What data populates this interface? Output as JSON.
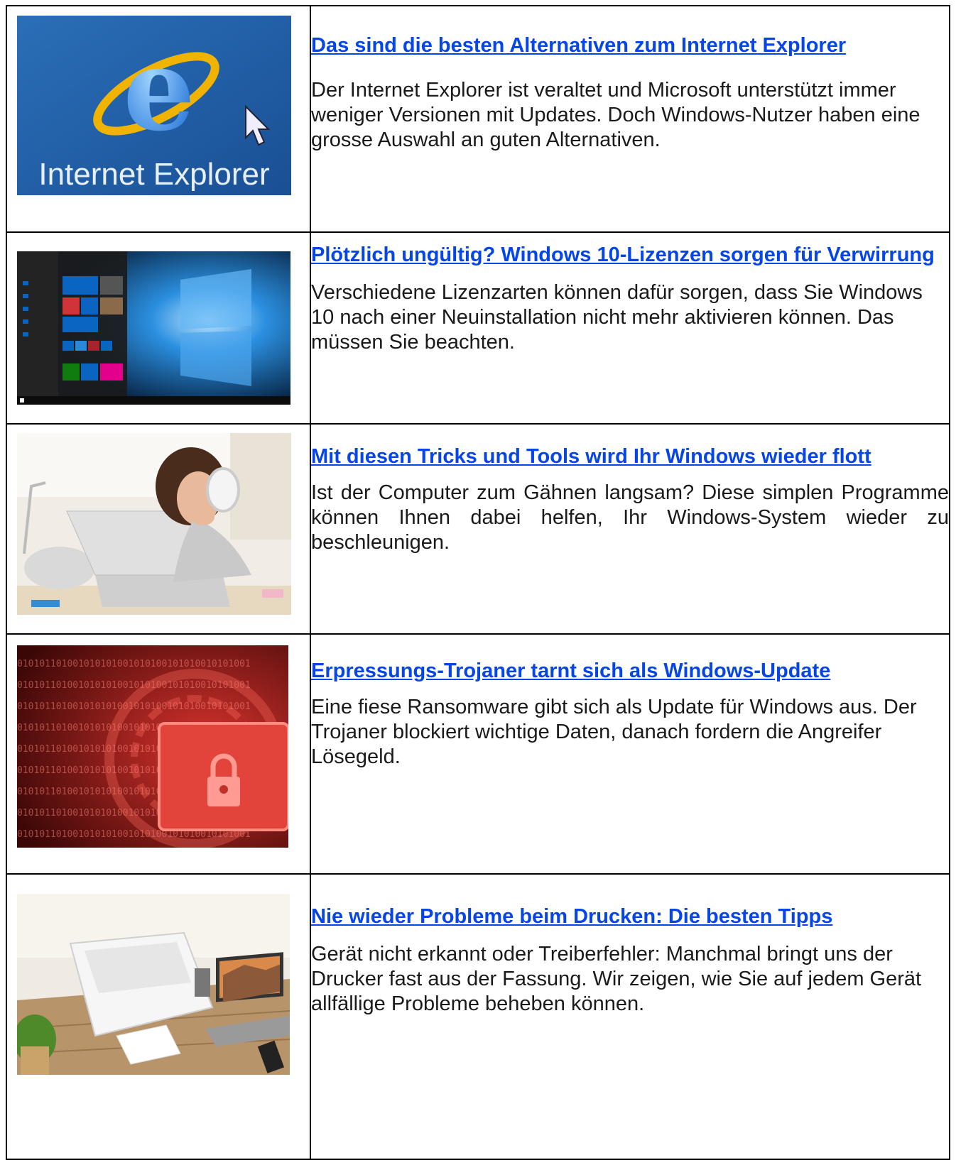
{
  "articles": [
    {
      "title": "Das sind die besten Alternativen zum Internet Explorer",
      "summary": "Der Internet Explorer ist veraltet und Microsoft unterstützt immer weniger Versionen mit Updates. Doch Windows-Nutzer haben eine grosse Auswahl an guten Alternativen.",
      "image_caption": "Internet Explorer"
    },
    {
      "title": "Plötzlich ungültig? Windows 10-Lizenzen sorgen für Verwirrung",
      "summary": "Verschiedene Lizenzarten können dafür sorgen, dass Sie Windows 10 nach einer Neuinstallation nicht mehr aktivieren können. Das müssen Sie beachten."
    },
    {
      "title": "Mit diesen Tricks und Tools wird Ihr Windows wieder flott",
      "summary": "Ist der Computer zum Gähnen langsam? Diese simplen Programme können Ihnen dabei helfen, Ihr Windows-System wieder zu beschleunigen."
    },
    {
      "title": "Erpressungs-Trojaner tarnt sich als Windows-Update",
      "summary": "Eine fiese Ransomware gibt sich als Update für Windows aus. Der Trojaner blockiert wichtige Daten, danach fordern die Angreifer Lösegeld.",
      "image_text": "010101101001010101001010100101010010101001"
    },
    {
      "title": "Nie wieder Probleme beim Drucken: Die besten Tipps",
      "summary": "Gerät nicht erkannt oder Treiberfehler: Manchmal bringt uns der Drucker fast aus der Fassung. Wir zeigen, wie Sie auf jedem Gerät allfällige Probleme beheben können."
    }
  ]
}
